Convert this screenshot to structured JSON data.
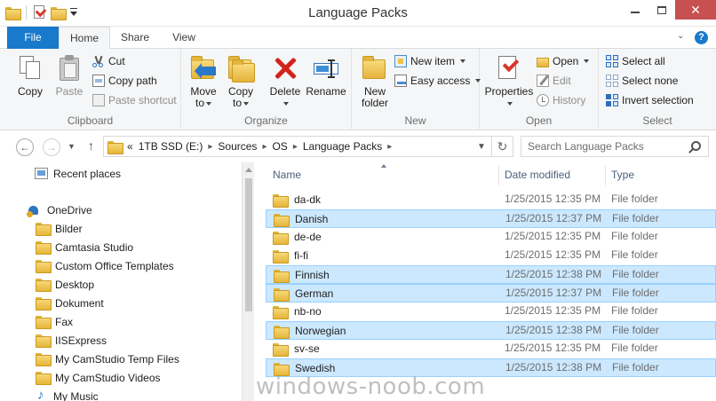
{
  "window": {
    "title": "Language Packs",
    "minimize_glyph": "",
    "maximize_glyph": "",
    "close_glyph": "✕"
  },
  "ribbon_tabs": [
    {
      "label": "File"
    },
    {
      "label": "Home"
    },
    {
      "label": "Share"
    },
    {
      "label": "View"
    }
  ],
  "ribbon": {
    "clipboard": {
      "label": "Clipboard",
      "copy": "Copy",
      "paste": "Paste",
      "cut": "Cut",
      "copy_path": "Copy path",
      "paste_shortcut": "Paste shortcut"
    },
    "organize": {
      "label": "Organize",
      "move_to_l1": "Move",
      "move_to_l2": "to",
      "copy_to_l1": "Copy",
      "copy_to_l2": "to",
      "delete": "Delete",
      "rename": "Rename"
    },
    "new": {
      "label": "New",
      "new_folder_l1": "New",
      "new_folder_l2": "folder",
      "new_item": "New item",
      "easy_access": "Easy access"
    },
    "open": {
      "label": "Open",
      "properties": "Properties",
      "open": "Open",
      "edit": "Edit",
      "history": "History"
    },
    "select": {
      "label": "Select",
      "select_all": "Select all",
      "select_none": "Select none",
      "invert_selection": "Invert selection"
    }
  },
  "address": {
    "overflow": "«",
    "breadcrumb": [
      "1TB SSD (E:)",
      "Sources",
      "OS",
      "Language Packs"
    ],
    "search_placeholder": "Search Language Packs"
  },
  "nav_pane": {
    "items": [
      {
        "label": "Recent places",
        "icon": "recent-places-icon"
      },
      {
        "label": "OneDrive",
        "icon": "onedrive-icon"
      },
      {
        "label": "Bilder",
        "icon": "folder-icon"
      },
      {
        "label": "Camtasia Studio",
        "icon": "folder-icon"
      },
      {
        "label": "Custom Office Templates",
        "icon": "folder-icon"
      },
      {
        "label": "Desktop",
        "icon": "folder-icon"
      },
      {
        "label": "Dokument",
        "icon": "folder-icon"
      },
      {
        "label": "Fax",
        "icon": "folder-icon"
      },
      {
        "label": "IISExpress",
        "icon": "folder-icon"
      },
      {
        "label": "My CamStudio Temp Files",
        "icon": "folder-icon"
      },
      {
        "label": "My CamStudio Videos",
        "icon": "folder-icon"
      },
      {
        "label": "My Music",
        "icon": "music-icon"
      }
    ]
  },
  "file_list": {
    "columns": [
      "Name",
      "Date modified",
      "Type"
    ],
    "rows": [
      {
        "name": "da-dk",
        "date": "1/25/2015 12:35 PM",
        "type": "File folder",
        "selected": false
      },
      {
        "name": "Danish",
        "date": "1/25/2015 12:37 PM",
        "type": "File folder",
        "selected": true
      },
      {
        "name": "de-de",
        "date": "1/25/2015 12:35 PM",
        "type": "File folder",
        "selected": false
      },
      {
        "name": "fi-fi",
        "date": "1/25/2015 12:35 PM",
        "type": "File folder",
        "selected": false
      },
      {
        "name": "Finnish",
        "date": "1/25/2015 12:38 PM",
        "type": "File folder",
        "selected": true
      },
      {
        "name": "German",
        "date": "1/25/2015 12:37 PM",
        "type": "File folder",
        "selected": true
      },
      {
        "name": "nb-no",
        "date": "1/25/2015 12:35 PM",
        "type": "File folder",
        "selected": false
      },
      {
        "name": "Norwegian",
        "date": "1/25/2015 12:38 PM",
        "type": "File folder",
        "selected": true
      },
      {
        "name": "sv-se",
        "date": "1/25/2015 12:35 PM",
        "type": "File folder",
        "selected": false
      },
      {
        "name": "Swedish",
        "date": "1/25/2015 12:38 PM",
        "type": "File folder",
        "selected": true
      }
    ]
  },
  "watermark": "windows-noob.com",
  "colors": {
    "file_tab": "#1979ca",
    "selection_fill": "#cce8ff",
    "selection_border": "#99d1ff",
    "close_button": "#c75050",
    "folder": "#e6b53a"
  }
}
